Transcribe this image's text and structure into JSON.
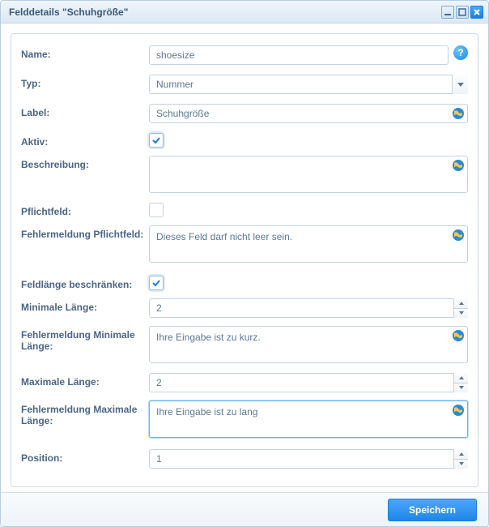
{
  "window": {
    "title": "Felddetails \"Schuhgröße\""
  },
  "labels": {
    "name": "Name:",
    "typ": "Typ:",
    "label": "Label:",
    "aktiv": "Aktiv:",
    "beschreibung": "Beschreibung:",
    "pflichtfeld": "Pflichtfeld:",
    "fehlerPflicht": "Fehlermeldung Pflichtfeld:",
    "feldlaenge": "Feldlänge beschränken:",
    "minLaenge": "Minimale Länge:",
    "fehlerMin": "Fehlermeldung Minimale Länge:",
    "maxLaenge": "Maximale Länge:",
    "fehlerMax": "Fehlermeldung Maximale Länge:",
    "position": "Position:"
  },
  "values": {
    "name": "shoesize",
    "typ": "Nummer",
    "label": "Schuhgröße",
    "aktiv": true,
    "beschreibung": "",
    "pflichtfeld": false,
    "fehlerPflicht": "Dieses Feld darf nicht leer sein.",
    "feldlaenge": true,
    "minLaenge": "2",
    "fehlerMin": "Ihre Eingabe ist zu kurz.",
    "maxLaenge": "2",
    "fehlerMax": "Ihre Eingabe ist zu lang",
    "position": "1"
  },
  "buttons": {
    "save": "Speichern"
  }
}
